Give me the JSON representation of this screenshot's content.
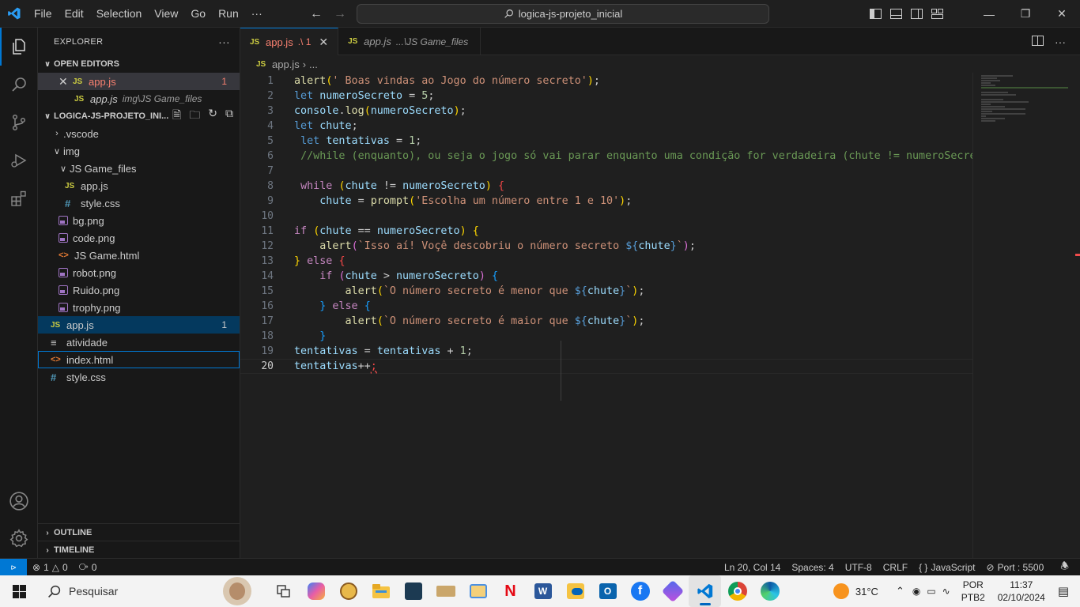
{
  "menu": [
    "File",
    "Edit",
    "Selection",
    "View",
    "Go",
    "Run",
    "···"
  ],
  "search_title": "logica-js-projeto_inicial",
  "explorer": {
    "title": "EXPLORER",
    "more": "···",
    "open_editors_label": "OPEN EDITORS",
    "open_editors": [
      {
        "name": "app.js",
        "badge": "1"
      },
      {
        "name": "app.js",
        "path": "img\\JS Game_files"
      }
    ],
    "project_label": "LOGICA-JS-PROJETO_INI...",
    "tree": {
      "vscode": ".vscode",
      "img": "img",
      "js_game_files": "JS Game_files",
      "jgf_appjs": "app.js",
      "jgf_stylecss": "style.css",
      "bg": "bg.png",
      "code": "code.png",
      "jsgame": "JS Game.html",
      "robot": "robot.png",
      "ruido": "Ruido.png",
      "trophy": "trophy.png",
      "appjs": "app.js",
      "appjs_badge": "1",
      "atividade": "atividade",
      "index": "index.html",
      "style": "style.css"
    },
    "outline": "OUTLINE",
    "timeline": "TIMELINE"
  },
  "tabs": [
    {
      "name": "app.js",
      "suffix": ".\\ 1"
    },
    {
      "name": "app.js",
      "suffix": "...\\JS Game_files"
    }
  ],
  "breadcrumb": {
    "file": "app.js",
    "more": "..."
  },
  "editor": {
    "line_numbers": [
      "1",
      "2",
      "3",
      "4",
      "5",
      "6",
      "7",
      "8",
      "9",
      "10",
      "11",
      "12",
      "13",
      "14",
      "15",
      "16",
      "17",
      "18",
      "19",
      "20"
    ],
    "current_line": 20
  },
  "status": {
    "errors": "1",
    "warnings": "0",
    "ports": "0",
    "position": "Ln 20, Col 14",
    "spaces": "Spaces: 4",
    "encoding": "UTF-8",
    "eol": "CRLF",
    "language": "JavaScript",
    "port": "Port : 5500"
  },
  "taskbar": {
    "search": "Pesquisar",
    "temp": "31°C",
    "lang1": "POR",
    "lang2": "PTB2",
    "time": "11:37",
    "date": "02/10/2024"
  },
  "colors": {
    "accent": "#0078d4",
    "bg": "#1f1f1f",
    "sidebar": "#181818"
  }
}
